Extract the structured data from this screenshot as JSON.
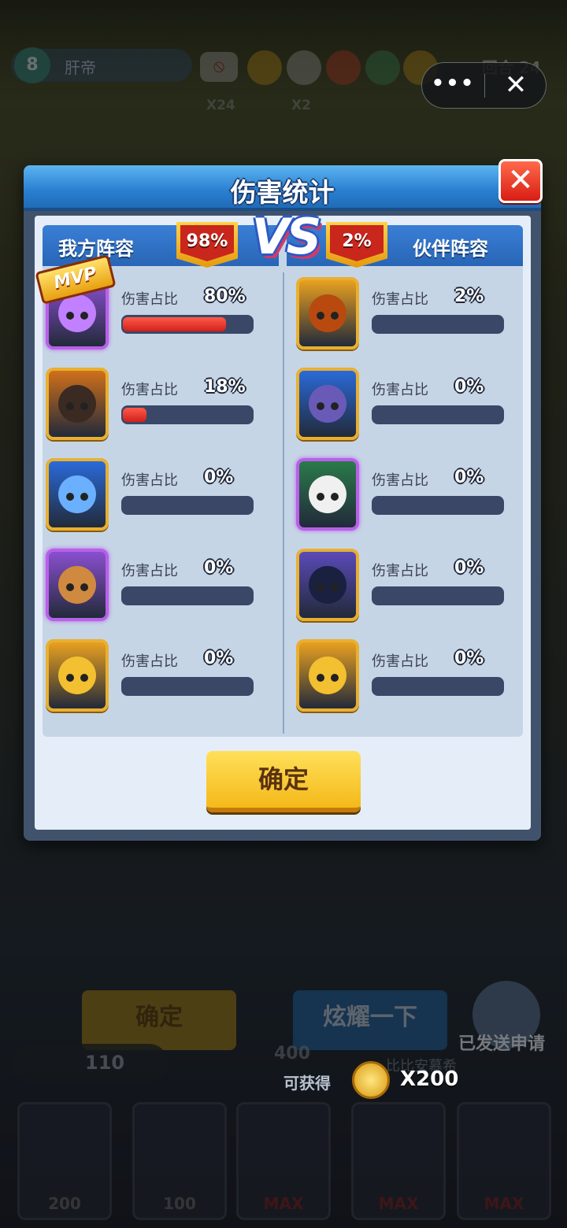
{
  "hud": {
    "level": "8",
    "player_name": "肝帝",
    "round_text": "回合 24",
    "stat1": "X24",
    "stat2": "X2",
    "capsule_more": "•••",
    "capsule_close": "✕"
  },
  "modal": {
    "title": "伤害统计",
    "close_icon": "✕",
    "vs": "VS",
    "left_team": {
      "name": "我方阵容",
      "pct": "98%"
    },
    "right_team": {
      "name": "伙伴阵容",
      "pct": "2%"
    },
    "mvp": "MVP",
    "confirm": "确定"
  },
  "left_rows": [
    {
      "label": "伤害占比",
      "value": "80%",
      "fill": 0.8,
      "color": "#8a4fd0",
      "face": "#c080ff"
    },
    {
      "label": "伤害占比",
      "value": "18%",
      "fill": 0.18,
      "color": "#d0701a",
      "face": "#3a2a22"
    },
    {
      "label": "伤害占比",
      "value": "0%",
      "fill": 0,
      "color": "#2a6ad8",
      "face": "#6ab0ff"
    },
    {
      "label": "伤害占比",
      "value": "0%",
      "fill": 0,
      "color": "#8a4fd0",
      "face": "#d08a40"
    },
    {
      "label": "伤害占比",
      "value": "0%",
      "fill": 0,
      "color": "#e8a020",
      "face": "#f2c030"
    }
  ],
  "right_rows": [
    {
      "label": "伤害占比",
      "value": "2%",
      "fill": 0.02,
      "color": "#e8a020",
      "face": "#b84a10"
    },
    {
      "label": "伤害占比",
      "value": "0%",
      "fill": 0,
      "color": "#2a6ad8",
      "face": "#6a5ab8"
    },
    {
      "label": "伤害占比",
      "value": "0%",
      "fill": 0,
      "color": "#2a7a4a",
      "face": "#f0f0f0"
    },
    {
      "label": "伤害占比",
      "value": "0%",
      "fill": 0,
      "color": "#5a4ab8",
      "face": "#1a2040"
    },
    {
      "label": "伤害占比",
      "value": "0%",
      "fill": 0,
      "color": "#e8a020",
      "face": "#f2c030"
    }
  ],
  "bottom": {
    "confirm": "确定",
    "show_off": "炫耀一下",
    "applied": "已发送申请",
    "coins": "110",
    "cost400": "400",
    "bibi": "比比安慕希",
    "can_get": "可获得",
    "reward": "X200",
    "cards": [
      "200",
      "100",
      "MAX",
      "MAX",
      "MAX"
    ]
  }
}
